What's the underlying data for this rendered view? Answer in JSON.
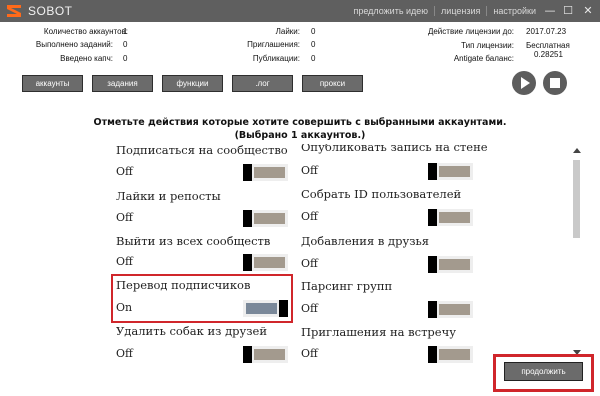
{
  "app": {
    "title": "SOBOT",
    "links": [
      "предложить идею",
      "лицензия",
      "настройки"
    ],
    "window_controls": {
      "minimize": "—",
      "maximize": "☐",
      "close": "✕"
    }
  },
  "info": {
    "accounts_label": "Количество аккаунтов:",
    "accounts_value": "1",
    "tasks_label": "Выполнено заданий:",
    "tasks_value": "0",
    "captcha_label": "Введено капч:",
    "captcha_value": "0",
    "likes_label": "Лайки:",
    "likes_value": "0",
    "invites_label": "Приглашения:",
    "invites_value": "0",
    "posts_label": "Публикации:",
    "posts_value": "0",
    "license_until_label": "Действие лицензии до:",
    "license_until_value": "2017.07.23",
    "license_type_label": "Тип лицензии:",
    "license_type_value": "Бесплатная",
    "antigate_label": "Antigate баланс:",
    "antigate_value": "0.28251"
  },
  "tabs": [
    "аккаунты",
    "задания",
    "функции",
    ".лог",
    "прокси"
  ],
  "instruction": {
    "line1": "Отметьте действия которые хотите совершить с выбранными аккаунтами.",
    "line2": "(Выбрано 1 аккаунтов.)"
  },
  "actions_left": [
    {
      "title": "Подписаться на сообщество",
      "state": "Off",
      "on": false
    },
    {
      "title": "Лайки и репосты",
      "state": "Off",
      "on": false
    },
    {
      "title": "Выйти из всех сообществ",
      "state": "Off",
      "on": false
    },
    {
      "title": "Перевод подписчиков",
      "state": "On",
      "on": true
    },
    {
      "title": "Удалить собак из друзей",
      "state": "Off",
      "on": false
    }
  ],
  "actions_right": [
    {
      "title": "Опубликовать запись на стене",
      "state": "Off",
      "on": false
    },
    {
      "title": "Собрать ID пользователей",
      "state": "Off",
      "on": false
    },
    {
      "title": "Добавления в друзья",
      "state": "Off",
      "on": false
    },
    {
      "title": "Парсинг групп",
      "state": "Off",
      "on": false
    },
    {
      "title": "Приглашения на встречу",
      "state": "Off",
      "on": false
    }
  ],
  "continue_label": "продолжить",
  "colors": {
    "accent_red": "#d0262b",
    "titlebar": "#5f5f5f",
    "button": "#6b6b6b"
  }
}
